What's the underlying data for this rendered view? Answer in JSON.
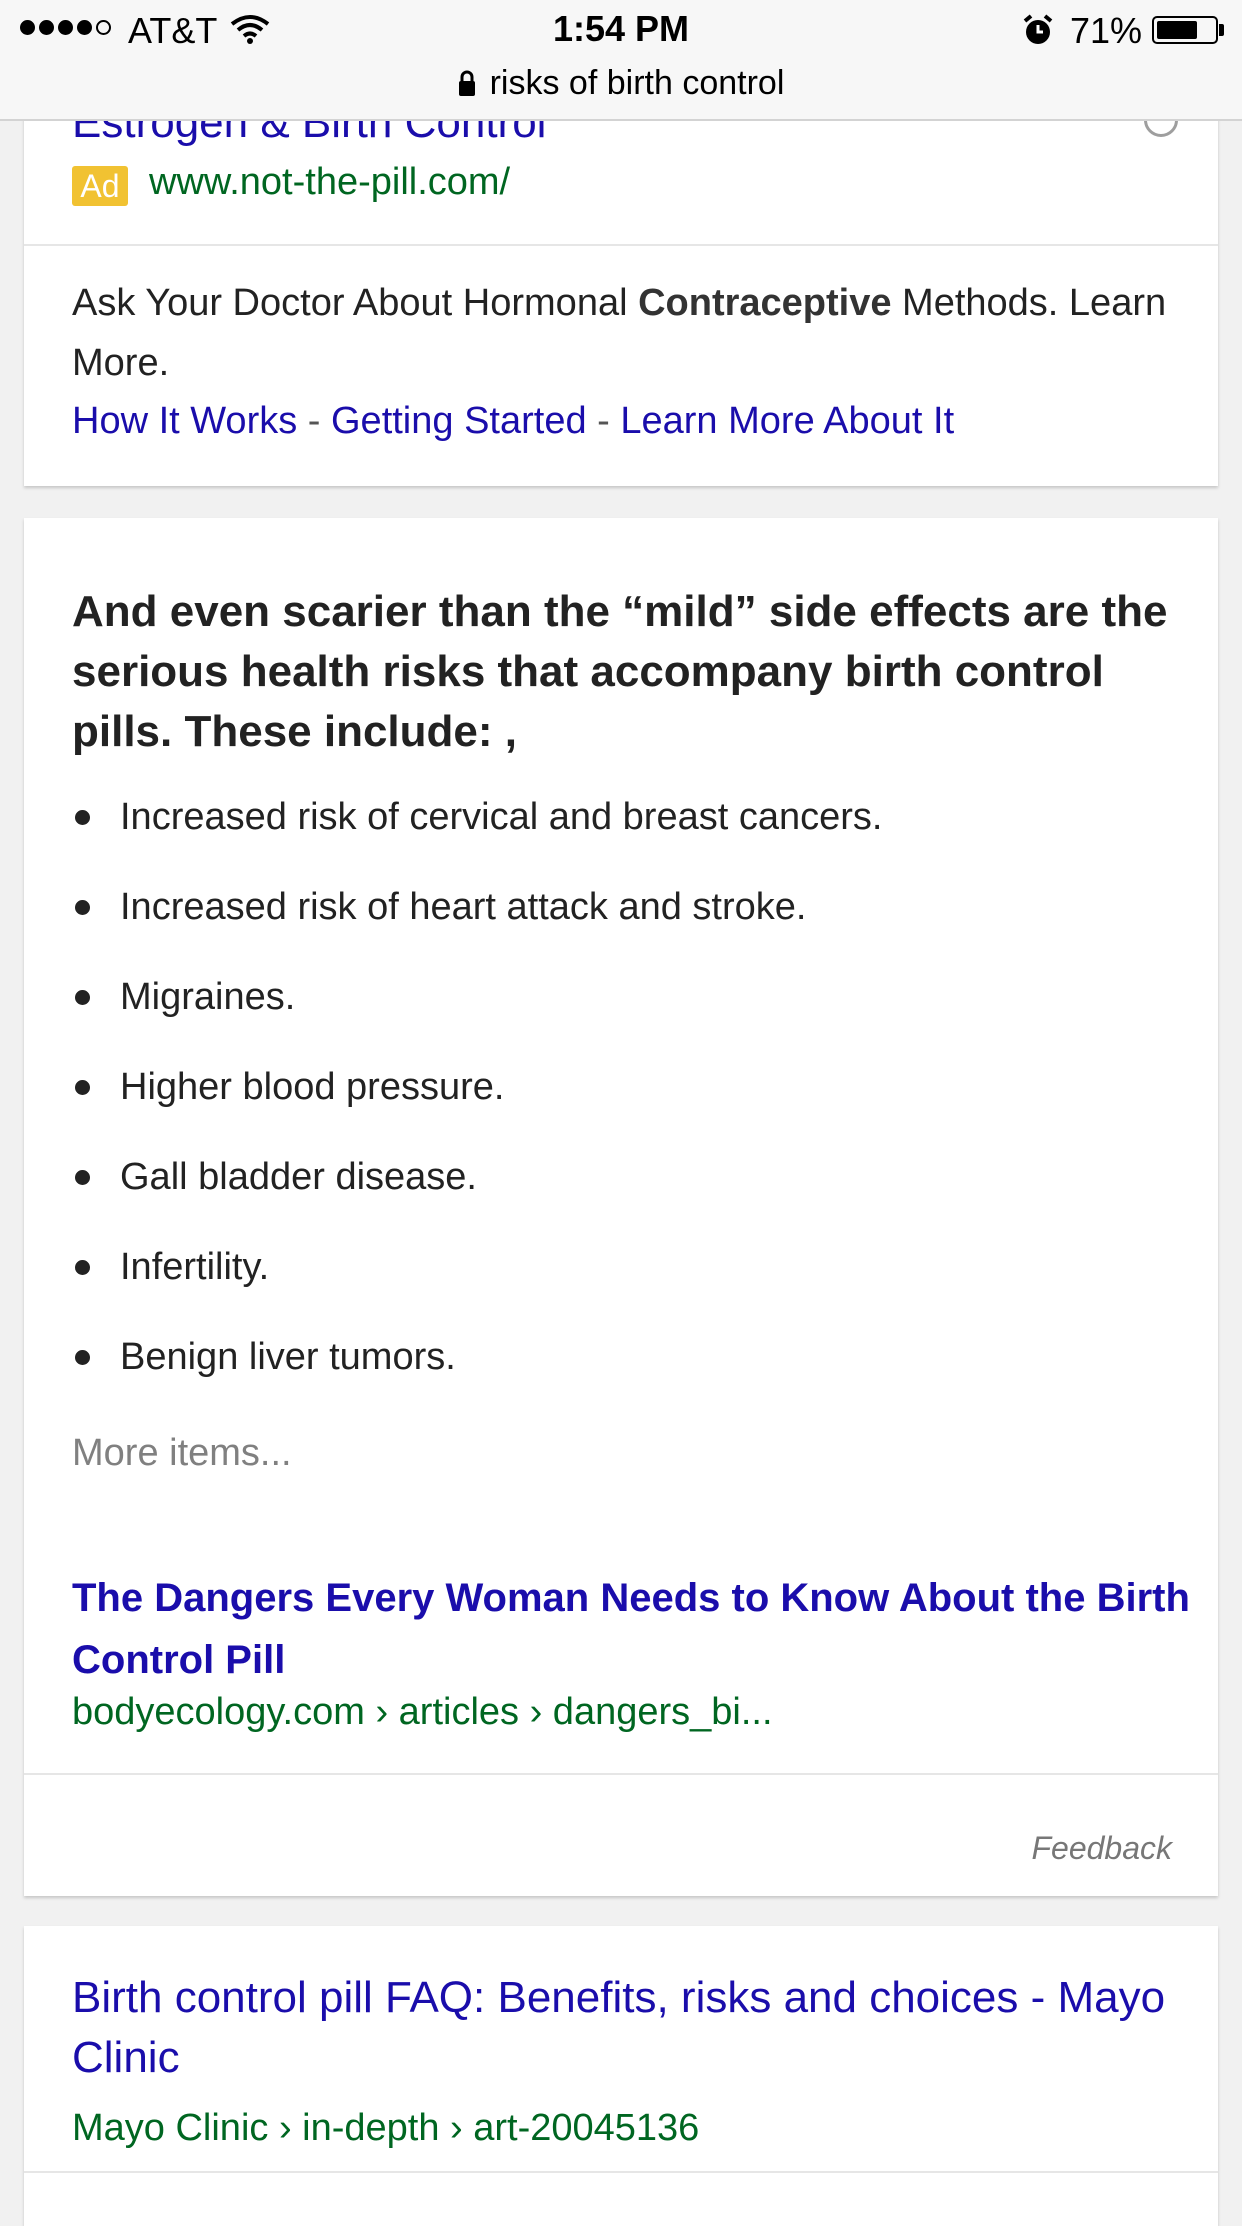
{
  "status_bar": {
    "carrier": "AT&T",
    "time": "1:54 PM",
    "battery_percent": "71%",
    "battery_level": 0.71,
    "icons": [
      "signal-dots-icon",
      "wifi-icon",
      "alarm-clock-icon",
      "battery-icon"
    ]
  },
  "address_bar": {
    "query": "risks of birth control",
    "icon": "lock-icon"
  },
  "ad_card": {
    "title": "Estrogen & Birth Control",
    "badge": "Ad",
    "url": "www.not-the-pill.com/",
    "description_before": "Ask Your Doctor About Hormonal ",
    "description_bold": "Contraceptive",
    "description_after": " Methods. Learn More.",
    "sitelinks": [
      "How It Works",
      "Getting Started",
      "Learn More About It"
    ],
    "separator": " - "
  },
  "featured_snippet": {
    "heading": "And even scarier than the “mild” side effects are the serious health risks that accompany birth control pills. These include: ,",
    "items": [
      "Increased risk of cervical and breast cancers.",
      "Increased risk of heart attack and stroke.",
      "Migraines.",
      "Higher blood pressure.",
      "Gall bladder disease.",
      "Infertility.",
      "Benign liver tumors."
    ],
    "more_items": "More items...",
    "source_title": "The Dangers Every Woman Needs to Know About the Birth Control Pill",
    "source_url": "bodyecology.com › articles › dangers_bi...",
    "feedback": "Feedback"
  },
  "result": {
    "title": "Birth control pill FAQ: Benefits, risks and choices - Mayo Clinic",
    "url": "Mayo Clinic › in-depth › art-20045136"
  },
  "colors": {
    "link": "#1a0dab",
    "url_green": "#006621",
    "ad_badge": "#f1c232",
    "page_bg": "#f1f1f1"
  }
}
